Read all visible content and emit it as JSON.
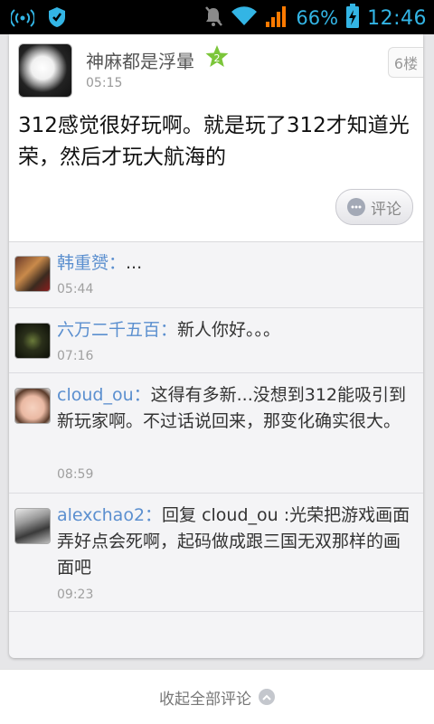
{
  "status_bar": {
    "battery_percent": "66%",
    "time": "12:46",
    "accent_color": "#33b5e5",
    "icons": [
      "wifi-hotspot-icon",
      "shield-icon",
      "mute-icon",
      "wifi-icon",
      "signal-icon",
      "battery-charging-icon"
    ]
  },
  "post": {
    "author": "神麻都是浮暈",
    "badge_level": "2",
    "time": "05:15",
    "floor": "6楼",
    "content": "312感觉很好玩啊。就是玩了312才知道光荣，然后才玩大航海的",
    "comment_button_label": "评论"
  },
  "comments": [
    {
      "name": "韩重赟：",
      "text": "...",
      "time": "05:44"
    },
    {
      "name": "六万二千五百：",
      "text": "新人你好。。。",
      "time": "07:16"
    },
    {
      "name": "cloud_ou：",
      "text": "这得有多新...没想到312能吸引到新玩家啊。不过话说回来，那变化确实很大。",
      "time": "08:59"
    },
    {
      "name": "alexchao2：",
      "text": "回复 cloud_ou :光荣把游戏画面弄好点会死啊，起码做成跟三国无双那样的画面吧",
      "time": "09:23"
    }
  ],
  "bottom_bar": {
    "collapse_label": "收起全部评论"
  }
}
